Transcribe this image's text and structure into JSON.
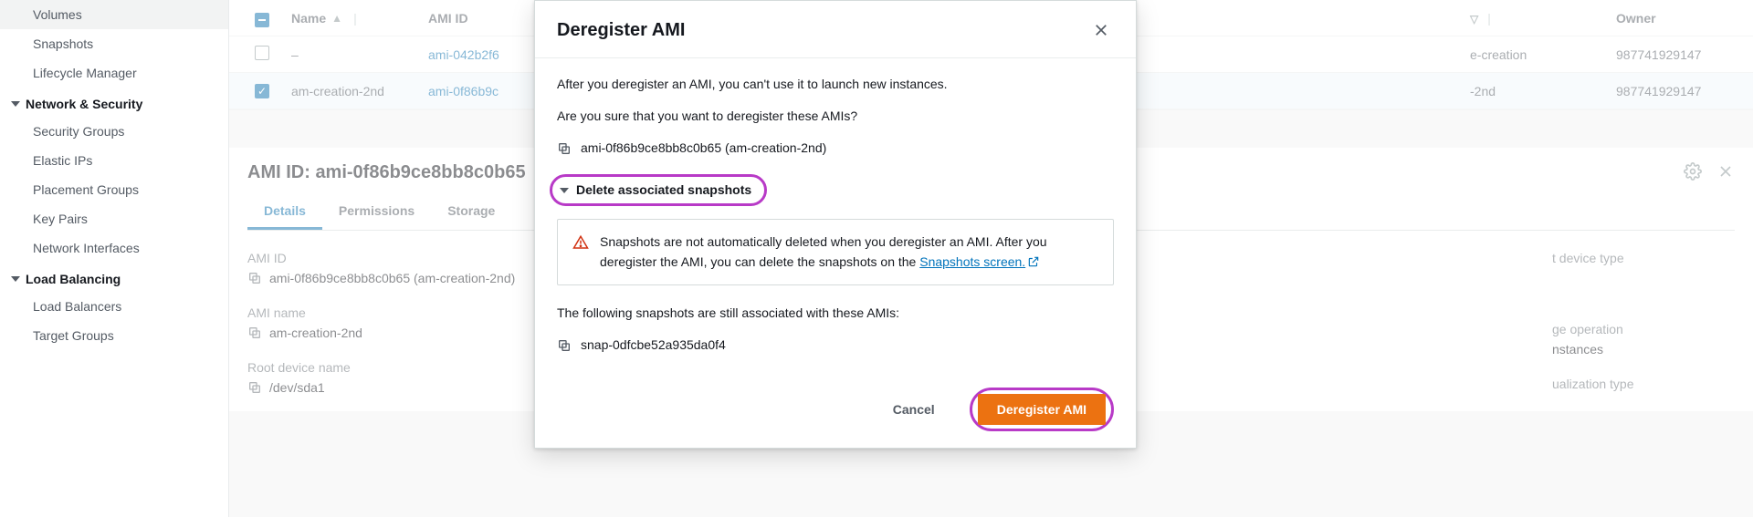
{
  "sidebar": {
    "ebs_items": [
      "Volumes",
      "Snapshots",
      "Lifecycle Manager"
    ],
    "section_net": "Network & Security",
    "net_items": [
      "Security Groups",
      "Elastic IPs",
      "Placement Groups",
      "Key Pairs",
      "Network Interfaces"
    ],
    "section_lb": "Load Balancing",
    "lb_items": [
      "Load Balancers",
      "Target Groups"
    ]
  },
  "table": {
    "headers": {
      "name": "Name",
      "ami_id": "AMI ID",
      "source": "",
      "owner": "Owner"
    },
    "rows": [
      {
        "checked": false,
        "name": "–",
        "ami_id": "ami-042b2f6",
        "source": "e-creation",
        "owner": "987741929147"
      },
      {
        "checked": true,
        "name": "am-creation-2nd",
        "ami_id": "ami-0f86b9c",
        "source": "-2nd",
        "owner": "987741929147"
      }
    ]
  },
  "detail": {
    "heading_prefix": "AMI ID: ",
    "heading_value": "ami-0f86b9ce8bb8c0b65",
    "tabs": [
      "Details",
      "Permissions",
      "Storage"
    ],
    "fields": {
      "ami_id_label": "AMI ID",
      "ami_id_value": "ami-0f86b9ce8bb8c0b65 (am-creation-2nd)",
      "ami_name_label": "AMI name",
      "ami_name_value": "am-creation-2nd",
      "root_dev_label": "Root device name",
      "root_dev_value": "/dev/sda1",
      "right1": "t device type",
      "right2": "ge operation",
      "right3": "nstances",
      "right4": "ualization type"
    }
  },
  "modal": {
    "title": "Deregister AMI",
    "intro": "After you deregister an AMI, you can't use it to launch new instances.",
    "confirm_q": "Are you sure that you want to deregister these AMIs?",
    "ami_line": "ami-0f86b9ce8bb8c0b65 (am-creation-2nd)",
    "expander_label": "Delete associated snapshots",
    "warn_text_a": "Snapshots are not automatically deleted when you deregister an AMI. After you deregister the AMI, you can delete the snapshots on the ",
    "warn_link": "Snapshots screen.",
    "snap_intro": "The following snapshots are still associated with these AMIs:",
    "snap_id": "snap-0dfcbe52a935da0f4",
    "cancel": "Cancel",
    "submit": "Deregister AMI"
  }
}
